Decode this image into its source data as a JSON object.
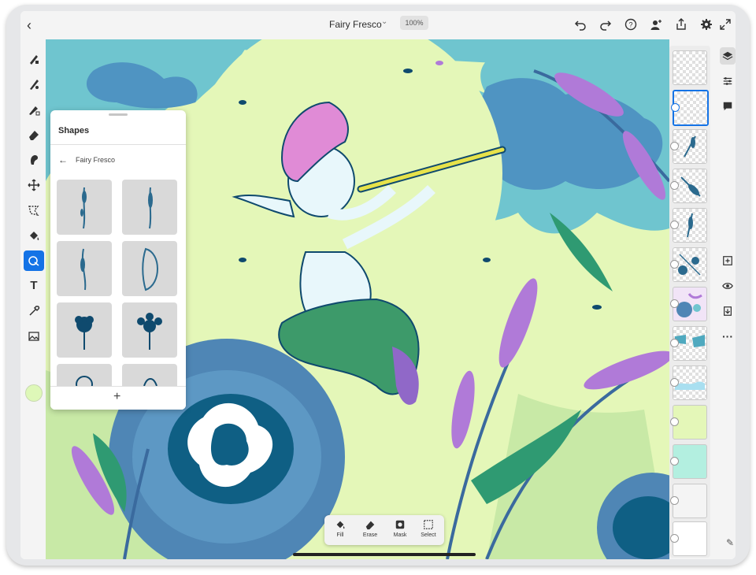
{
  "header": {
    "back_icon": "chevron-left-icon",
    "title": "Fairy Fresco",
    "zoom": "100%",
    "actions": [
      "undo-icon",
      "redo-icon",
      "help-icon",
      "user-add-icon",
      "share-icon",
      "settings-icon",
      "expand-icon"
    ]
  },
  "tools": [
    "pixel-brush-icon",
    "live-brush-icon",
    "vector-brush-icon",
    "eraser-icon",
    "smudge-icon",
    "move-icon",
    "lasso-icon",
    "fill-icon",
    "shapes-icon",
    "text-icon",
    "eyedropper-icon",
    "image-icon"
  ],
  "active_color": "#def8b8",
  "shapes_panel": {
    "title": "Shapes",
    "breadcrumb": "Fairy Fresco",
    "add_label": "+"
  },
  "layers_count": 13,
  "right_rail": [
    "layers-icon",
    "properties-icon",
    "comments-icon",
    "add-layer-icon",
    "visibility-icon",
    "import-icon",
    "more-icon"
  ],
  "bottom_bar": {
    "fill": "Fill",
    "erase": "Erase",
    "mask": "Mask",
    "select": "Select"
  },
  "colors": {
    "accent": "#1473e6",
    "canvas_bg": "#e4f7b8",
    "sky": "#5cb6c8",
    "flower": "#4f86b5",
    "lavender": "#b07ad8",
    "fairy_hair": "#e08bd6"
  }
}
